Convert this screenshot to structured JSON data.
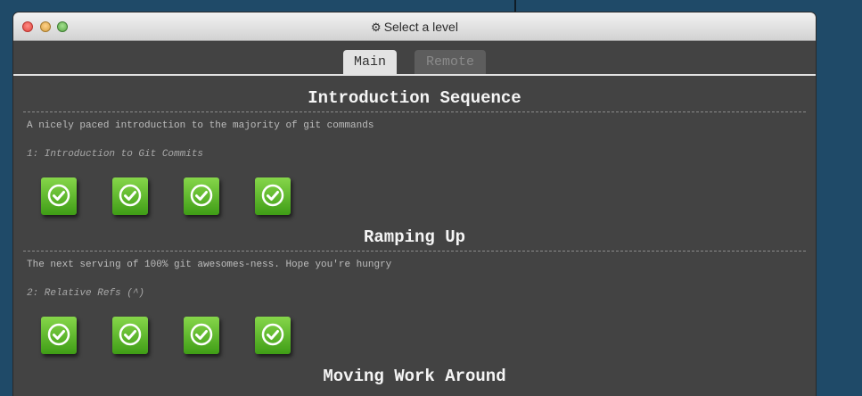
{
  "window": {
    "title": "Select a level",
    "title_icon": "gear-icon"
  },
  "tabs": [
    {
      "label": "Main",
      "active": true
    },
    {
      "label": "Remote",
      "active": false
    }
  ],
  "sequences": [
    {
      "title": "Introduction Sequence",
      "description": "A nicely paced introduction to the majority of git commands",
      "about": "1: Introduction to Git Commits",
      "levels": [
        {
          "status": "completed",
          "icon": "check-circle-icon"
        },
        {
          "status": "completed",
          "icon": "check-circle-icon"
        },
        {
          "status": "completed",
          "icon": "check-circle-icon"
        },
        {
          "status": "completed",
          "icon": "check-circle-icon"
        }
      ]
    },
    {
      "title": "Ramping Up",
      "description": "The next serving of 100% git awesomes-ness. Hope you're hungry",
      "about": "2: Relative Refs (^)",
      "levels": [
        {
          "status": "completed",
          "icon": "check-circle-icon"
        },
        {
          "status": "completed",
          "icon": "check-circle-icon"
        },
        {
          "status": "completed",
          "icon": "check-circle-icon"
        },
        {
          "status": "completed",
          "icon": "check-circle-icon"
        }
      ]
    },
    {
      "title": "Moving Work Around"
    }
  ],
  "colors": {
    "desktop_bg": "#1f4a68",
    "window_bg": "#434343",
    "level_complete": "#5cb82b"
  }
}
